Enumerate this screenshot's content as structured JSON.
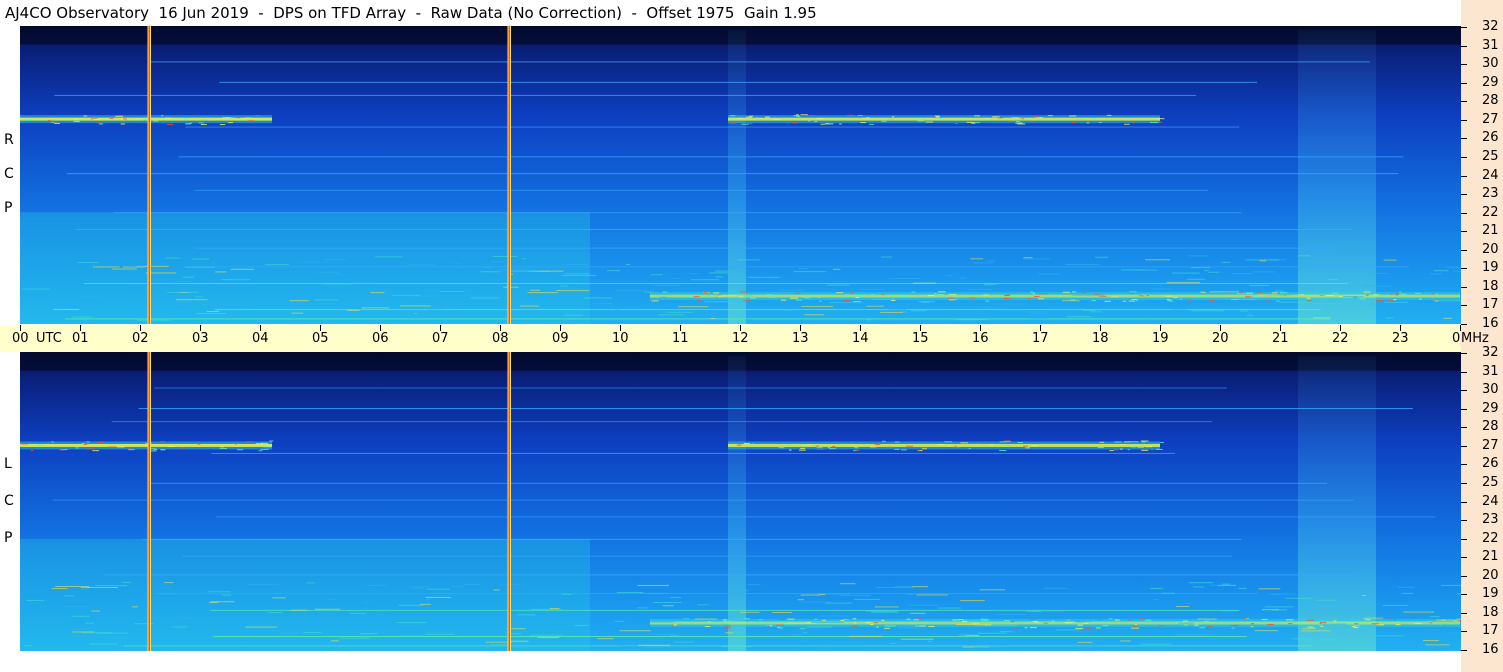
{
  "title": "AJ4CO Observatory  16 Jun 2019  -  DPS on TFD Array  -  Raw Data (No Correction)  -  Offset 1975  Gain 1.95",
  "panels": [
    {
      "id": "rcp",
      "letters": [
        "R",
        "C",
        "P"
      ]
    },
    {
      "id": "lcp",
      "letters": [
        "L",
        "C",
        "P"
      ]
    }
  ],
  "time_labels": [
    "00",
    "UTC",
    "01",
    "02",
    "03",
    "04",
    "05",
    "06",
    "07",
    "08",
    "09",
    "10",
    "11",
    "12",
    "13",
    "14",
    "15",
    "16",
    "17",
    "18",
    "19",
    "20",
    "21",
    "22",
    "23",
    "00",
    "MHz"
  ],
  "chart_data": {
    "type": "heatmap",
    "title": "AJ4CO Observatory  16 Jun 2019  -  DPS on TFD Array  -  Raw Data (No Correction)  -  Offset 1975  Gain 1.95",
    "x_axis": {
      "label": "UTC",
      "range_hours": [
        0,
        24
      ],
      "tick_labels": [
        "00",
        "01",
        "02",
        "03",
        "04",
        "05",
        "06",
        "07",
        "08",
        "09",
        "10",
        "11",
        "12",
        "13",
        "14",
        "15",
        "16",
        "17",
        "18",
        "19",
        "20",
        "21",
        "22",
        "23",
        "00"
      ]
    },
    "y_axis": {
      "unit": "MHz",
      "range": [
        16,
        32
      ],
      "tick_labels": [
        32,
        31,
        30,
        29,
        28,
        27,
        26,
        25,
        24,
        23,
        22,
        21,
        20,
        19,
        18,
        17,
        16
      ]
    },
    "series": [
      {
        "name": "RCP",
        "letters": "R C P"
      },
      {
        "name": "LCP",
        "letters": "L C P"
      }
    ],
    "colormap": [
      "#06113e",
      "#0a2a9a",
      "#1060e0",
      "#18a0f0",
      "#30e0c0",
      "#e0f040",
      "#ff4010"
    ],
    "features": {
      "vertical_marker_hours": [
        2.15,
        8.15
      ],
      "strong_bands": [
        {
          "freq_mhz": 27.0,
          "start_hour": 0.0,
          "end_hour": 4.2,
          "intensity": 0.9
        },
        {
          "freq_mhz": 27.0,
          "start_hour": 11.8,
          "end_hour": 19.0,
          "intensity": 0.85
        },
        {
          "freq_mhz": 17.5,
          "start_hour": 10.5,
          "end_hour": 24.0,
          "intensity": 0.6
        }
      ],
      "bright_vertical_regions_hours": [
        [
          11.8,
          12.1
        ],
        [
          21.3,
          22.6
        ]
      ]
    }
  },
  "colors": {
    "background_dark": "#06113e",
    "timebar_bg": "#ffffcc",
    "freq_axis_bg": "#fde6cf",
    "marker_red": "#ff5020",
    "marker_yellow": "#ffe060"
  }
}
